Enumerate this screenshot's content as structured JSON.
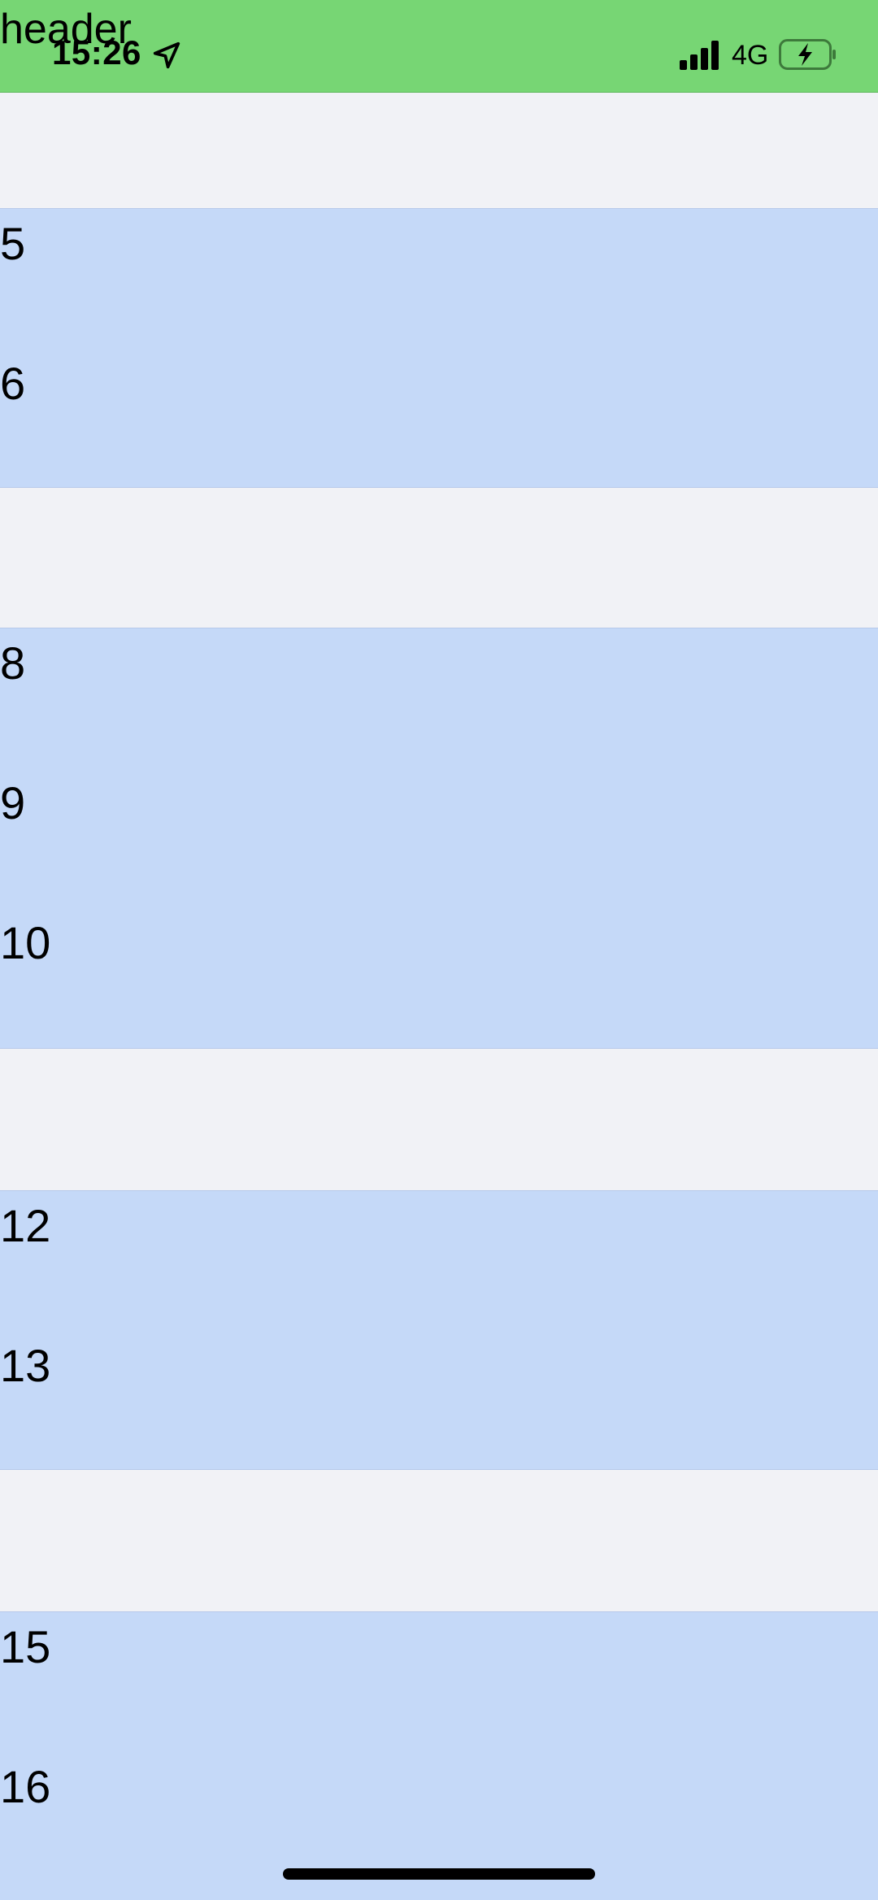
{
  "header": {
    "title": "header",
    "background": "#77d674"
  },
  "status_bar": {
    "time": "15:26",
    "network": "4G",
    "icons": [
      "location-arrow-icon",
      "signal-bars-icon",
      "battery-charging-icon"
    ]
  },
  "list": {
    "row_background": "#c5d9f8",
    "gap_background": "#f1f2f6",
    "groups": [
      {
        "items": [
          "5",
          "6"
        ]
      },
      {
        "items": [
          "8",
          "9",
          "10"
        ]
      },
      {
        "items": [
          "12",
          "13"
        ]
      },
      {
        "items": [
          "15",
          "16"
        ]
      }
    ]
  }
}
